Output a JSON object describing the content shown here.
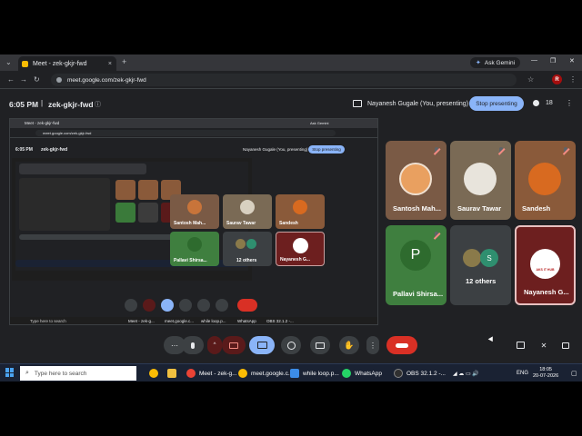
{
  "browser": {
    "tab_title": "Meet - zek-gkjr-fwd",
    "tab_close": "×",
    "new_tab": "+",
    "url": "meet.google.com/zek-gkjr-fwd",
    "ask_gemini": "Ask Gemini",
    "win_min": "—",
    "win_max": "❐",
    "win_close": "✕",
    "profile_letter": "R"
  },
  "meet": {
    "time": "6:05 PM",
    "separator": "|",
    "code": "zek-gkjr-fwd",
    "info_icon": "ⓘ",
    "presenter": "Nayanesh Gugale (You, presenting)",
    "stop_presenting": "Stop presenting",
    "people_count": "18",
    "more": "⋮"
  },
  "shared_screen": {
    "tab_title": "Meet - zek-gkjr-fwd",
    "ask_gemini": "Ask Gemini",
    "url": "meet.google.com/zek-gkjr-fwd",
    "time": "6:05 PM",
    "code": "zek-gkjr-fwd",
    "presenter": "Nayanesh Gugale (You, presenting)",
    "stop_presenting": "Stop presenting",
    "tiles": [
      {
        "name": "Santosh Mah..."
      },
      {
        "name": "Saurav Tawar"
      },
      {
        "name": "Sandesh"
      },
      {
        "name": "Pallavi Shirsa..."
      },
      {
        "name": "12 others"
      },
      {
        "name": "Nayanesh G..."
      }
    ],
    "taskbar_search": "Type here to search",
    "taskbar_items": [
      "Meet - zek-g...",
      "meet.google.c...",
      "while loop.p...",
      "WhatsApp",
      "OBS 32.1.2 -..."
    ]
  },
  "participants": [
    {
      "name": "Santosh Mah...",
      "color": "#7a5a45"
    },
    {
      "name": "Saurav Tawar",
      "color": "#7a6a55"
    },
    {
      "name": "Sandesh",
      "color": "#8a5a3a"
    },
    {
      "name": "Pallavi Shirsa...",
      "initial": "P",
      "color": "#3f7f3f"
    },
    {
      "name": "12 others",
      "color": "#3c4043"
    },
    {
      "name": "Nayanesh G...",
      "color": "#6d1f1f",
      "logo_text": "AKS IT HUB"
    }
  ],
  "others_badge": "S",
  "controls": {
    "more_options": "⋯",
    "mic_icon": "mic-icon",
    "camera_off_icon": "camera-off-icon",
    "present_icon": "present-icon",
    "emoji_icon": "emoji-icon",
    "captions_icon": "captions-icon",
    "hand_icon": "raise-hand-icon",
    "leave_icon": "leave-call-icon"
  },
  "taskbar": {
    "search_placeholder": "Type here to search",
    "items": [
      {
        "label": "Meet - zek-g...",
        "color": "#ea4335"
      },
      {
        "label": "meet.google.c...",
        "color": "#fbbc04"
      },
      {
        "label": "while loop.p...",
        "color": "#3c8ce7"
      },
      {
        "label": "WhatsApp",
        "color": "#25d366"
      },
      {
        "label": "OBS 32.1.2 -...",
        "color": "#303030"
      }
    ],
    "language": "ENG",
    "time": "18:05",
    "date": "20-07-2026"
  }
}
